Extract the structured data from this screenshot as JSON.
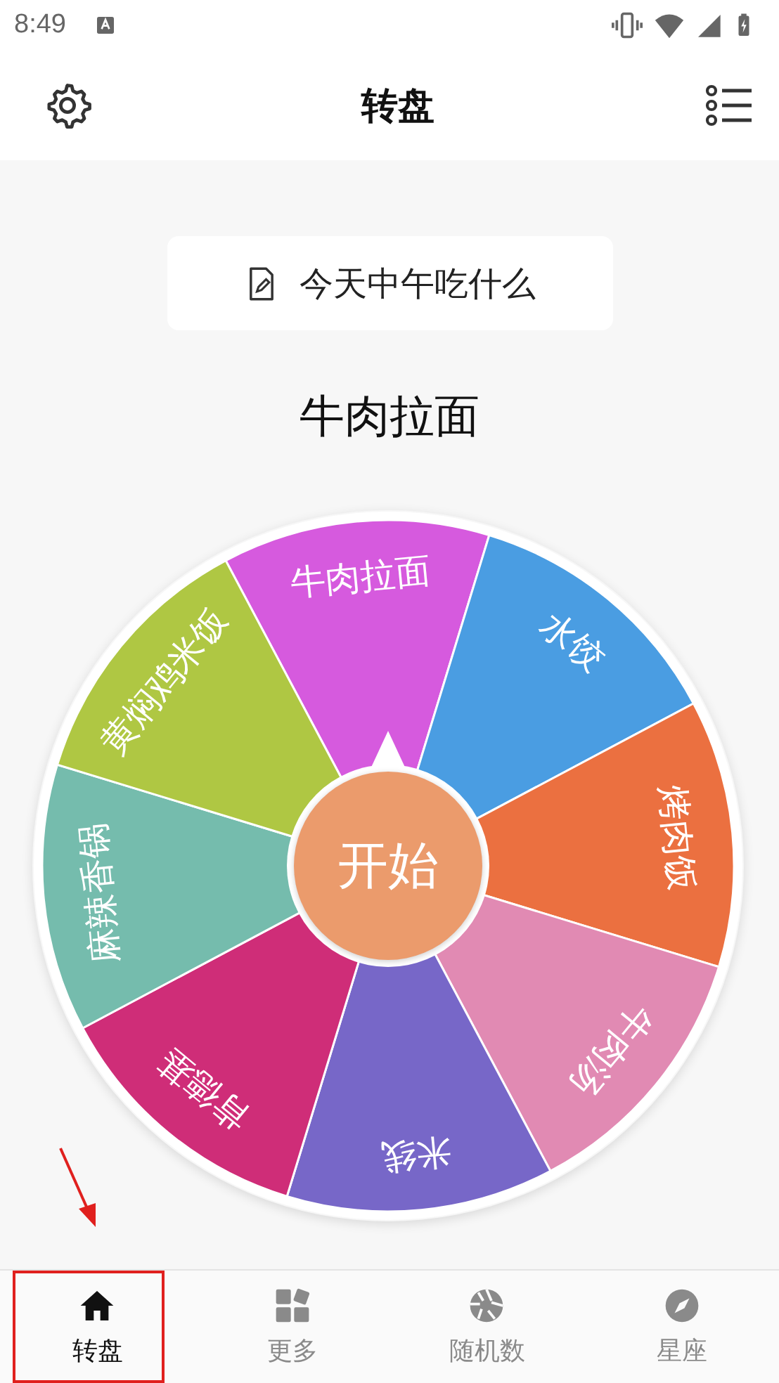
{
  "status_bar": {
    "time": "8:49"
  },
  "app_bar": {
    "title": "转盘"
  },
  "prompt": {
    "text": "今天中午吃什么"
  },
  "result": "牛肉拉面",
  "wheel": {
    "start_label": "开始",
    "segments": [
      {
        "label": "牛肉拉面",
        "color": "#d65ade"
      },
      {
        "label": "水饺",
        "color": "#4a9de2"
      },
      {
        "label": "烤肉饭",
        "color": "#eb7040"
      },
      {
        "label": "牛肉汤",
        "color": "#e18ab3"
      },
      {
        "label": "米线",
        "color": "#7767c8"
      },
      {
        "label": "肯德基",
        "color": "#cf2d78"
      },
      {
        "label": "麻辣香锅",
        "color": "#75bcad"
      },
      {
        "label": "黄焖鸡米饭",
        "color": "#afc743"
      }
    ]
  },
  "bottom_nav": [
    {
      "label": "转盘",
      "kind": "home",
      "selected": true
    },
    {
      "label": "更多",
      "kind": "more",
      "selected": false
    },
    {
      "label": "随机数",
      "kind": "aperture",
      "selected": false
    },
    {
      "label": "星座",
      "kind": "compass",
      "selected": false
    }
  ]
}
